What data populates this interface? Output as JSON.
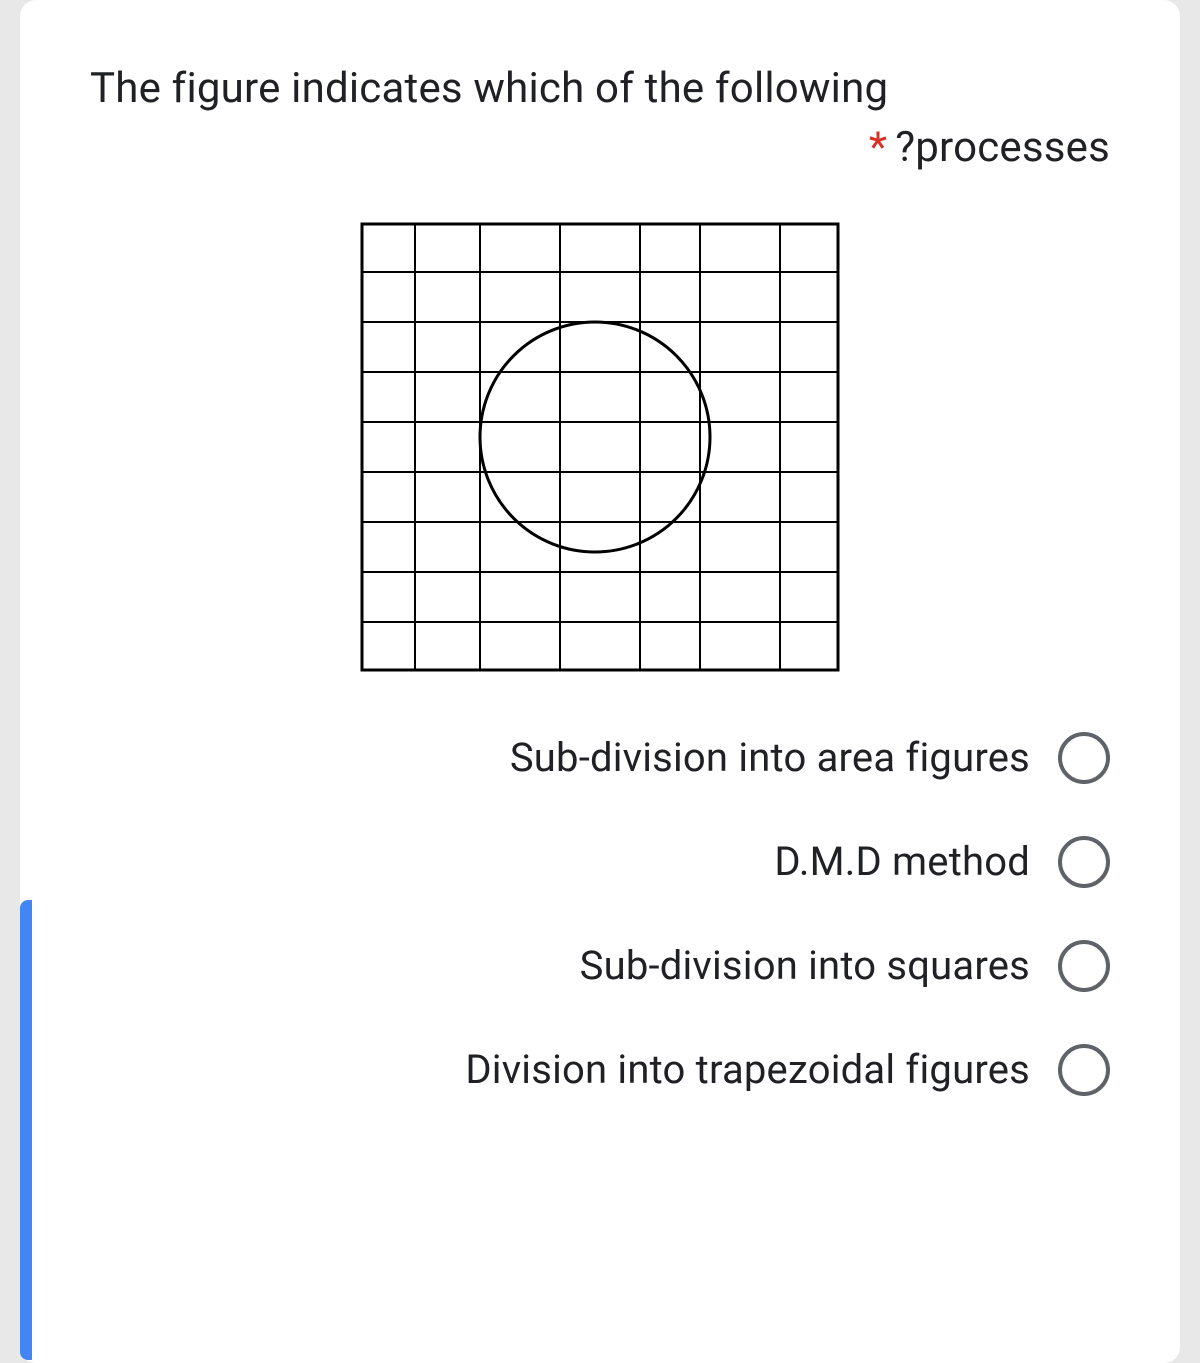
{
  "question": {
    "line1": "The figure indicates which of the following",
    "line2_suffix": "?processes",
    "required_mark": "*"
  },
  "options": [
    {
      "label": "Sub-division into area figures"
    },
    {
      "label": "D.M.D method"
    },
    {
      "label": "Sub-division into squares"
    },
    {
      "label": "Division into trapezoidal figures"
    }
  ]
}
